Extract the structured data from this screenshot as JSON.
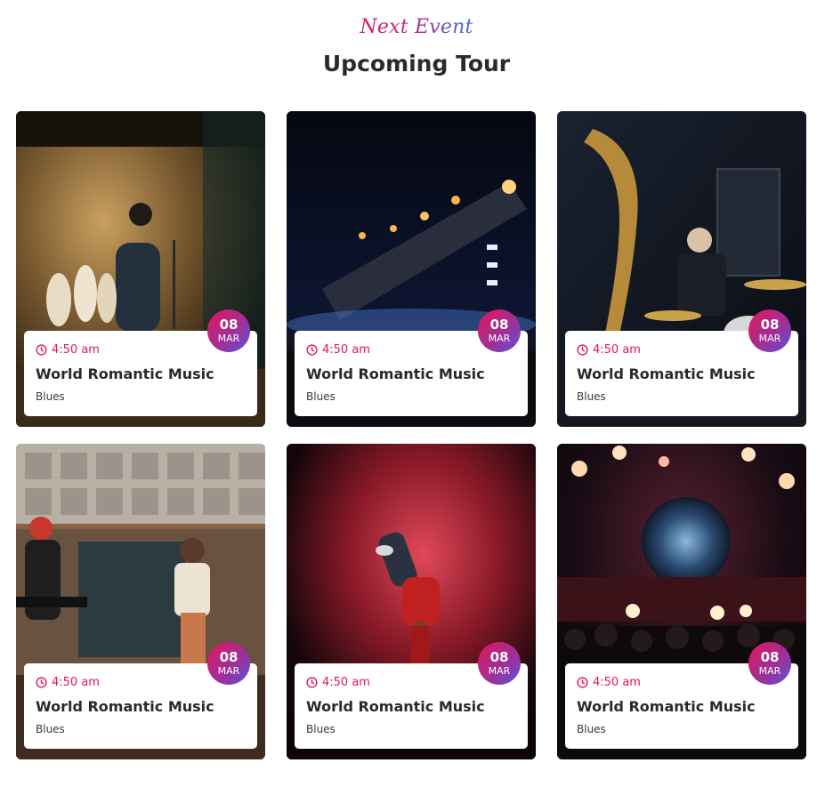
{
  "section": {
    "kicker": "Next Event",
    "title": "Upcoming Tour"
  },
  "events": [
    {
      "time": "4:50 am",
      "title": "World Romantic Music",
      "genre": "Blues",
      "day": "08",
      "month": "MAR",
      "photo": "stage-performer-dancers"
    },
    {
      "time": "4:50 am",
      "title": "World Romantic Music",
      "genre": "Blues",
      "day": "08",
      "month": "MAR",
      "photo": "concert-stage-pyrotechnics"
    },
    {
      "time": "4:50 am",
      "title": "World Romantic Music",
      "genre": "Blues",
      "day": "08",
      "month": "MAR",
      "photo": "saxophone-and-drummer"
    },
    {
      "time": "4:50 am",
      "title": "World Romantic Music",
      "genre": "Blues",
      "day": "08",
      "month": "MAR",
      "photo": "studio-singer-keyboard"
    },
    {
      "time": "4:50 am",
      "title": "World Romantic Music",
      "genre": "Blues",
      "day": "08",
      "month": "MAR",
      "photo": "breakdancer-red-smoke"
    },
    {
      "time": "4:50 am",
      "title": "World Romantic Music",
      "genre": "Blues",
      "day": "08",
      "month": "MAR",
      "photo": "concert-crowd-lights"
    }
  ],
  "colors": {
    "accent": "#e0194f",
    "badge_from": "#e2165a",
    "badge_to": "#5a52d8",
    "title_text": "#2b2b2b"
  },
  "icons": {
    "time": "clock-icon"
  }
}
